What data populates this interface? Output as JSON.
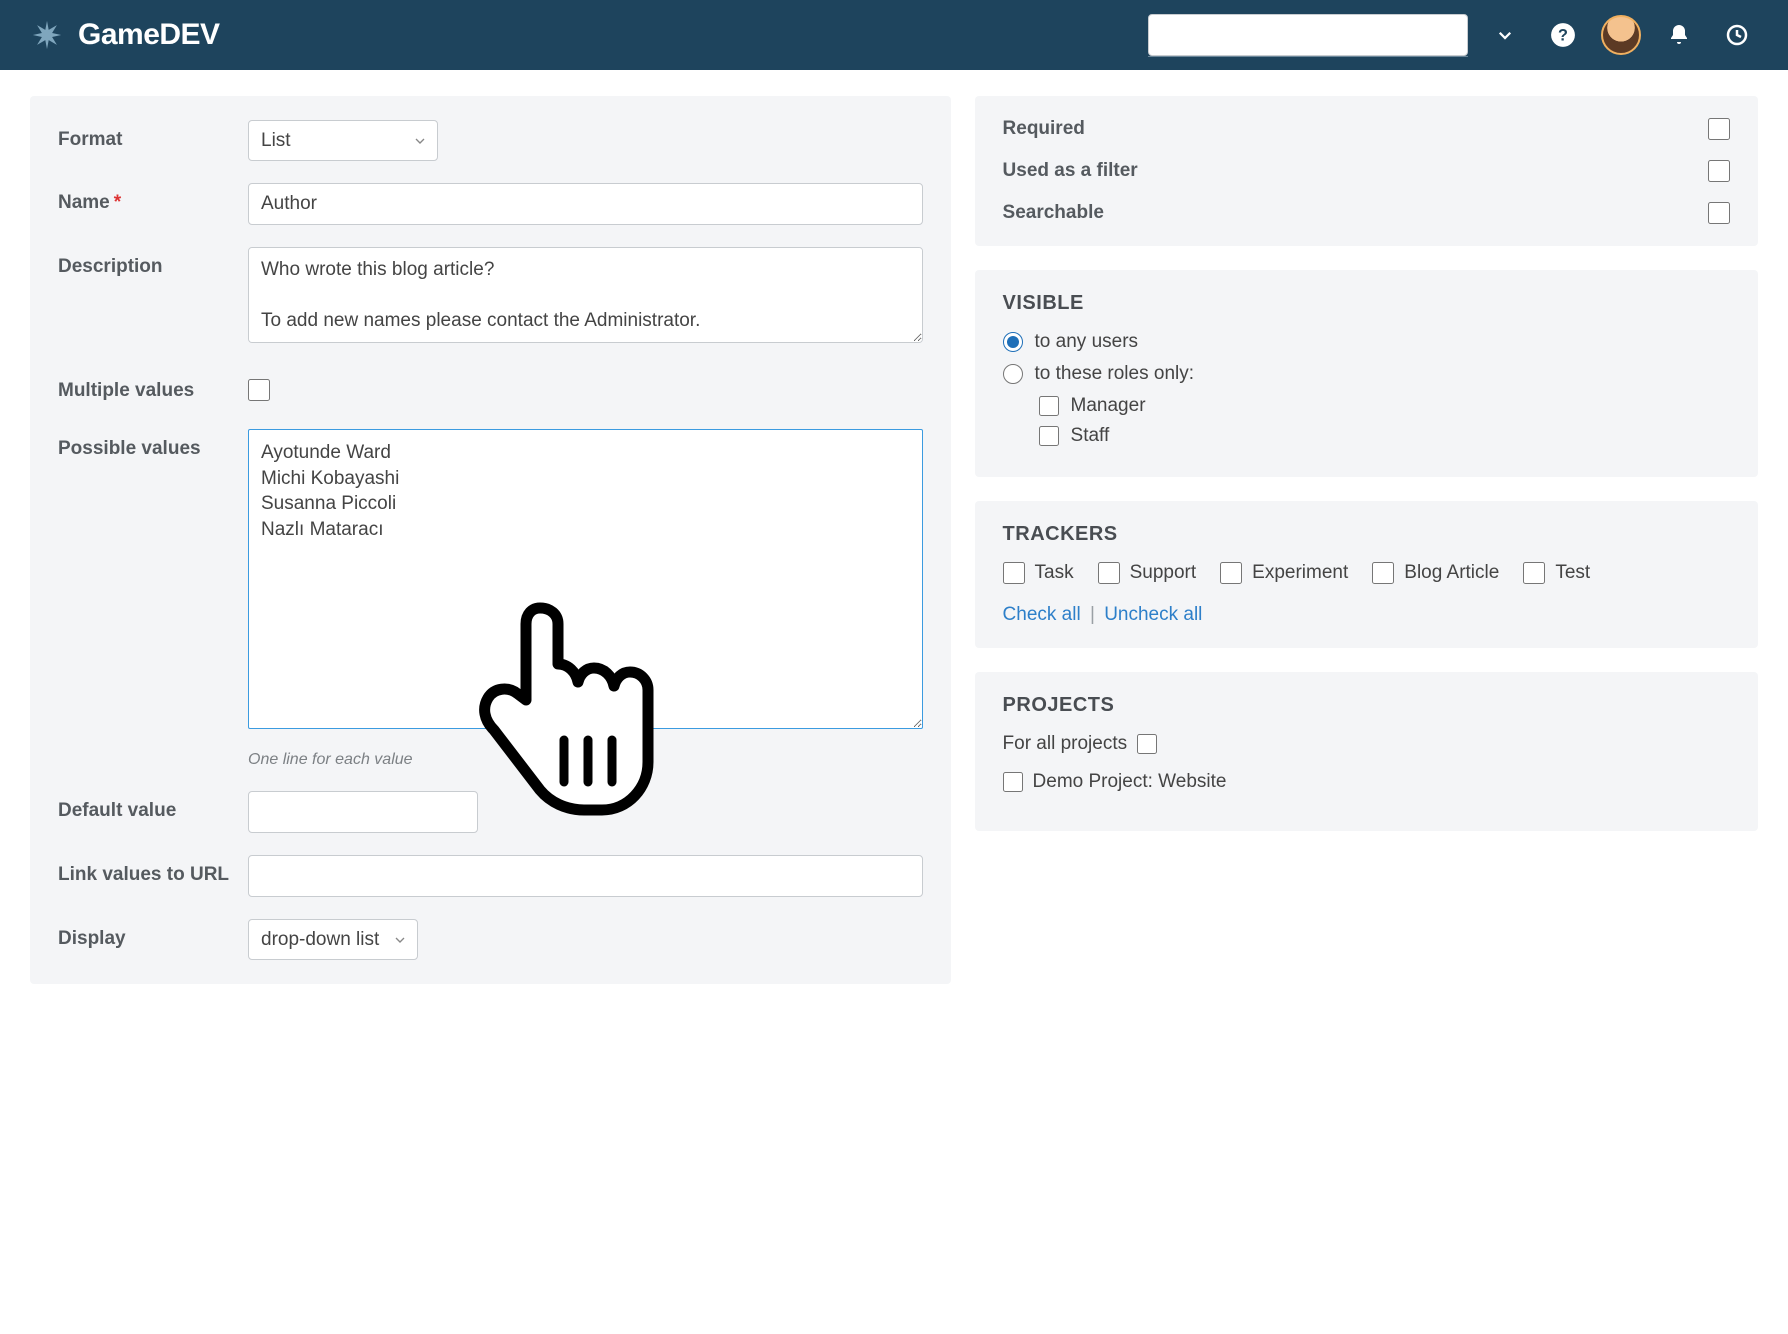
{
  "header": {
    "app_name": "GameDEV"
  },
  "left_form": {
    "format_label": "Format",
    "format_value": "List",
    "name_label": "Name",
    "name_value": "Author",
    "description_label": "Description",
    "description_value": "Who wrote this blog article?\n\nTo add new names please contact the Administrator.",
    "multiple_values_label": "Multiple values",
    "possible_values_label": "Possible values",
    "possible_values_value": "Ayotunde Ward\nMichi Kobayashi\nSusanna Piccoli\nNazlı Mataracı",
    "possible_values_hint": "One line for each value",
    "default_value_label": "Default value",
    "link_values_label": "Link values to URL",
    "display_label": "Display",
    "display_value": "drop-down list"
  },
  "options_panel": {
    "required": "Required",
    "used_as_filter": "Used as a filter",
    "searchable": "Searchable"
  },
  "visible_panel": {
    "title": "VISIBLE",
    "any_users": "to any users",
    "roles_only": "to these roles only:",
    "role_manager": "Manager",
    "role_staff": "Staff"
  },
  "trackers_panel": {
    "title": "TRACKERS",
    "items": [
      "Task",
      "Support",
      "Experiment",
      "Blog Article",
      "Test"
    ],
    "check_all": "Check all",
    "uncheck_all": "Uncheck all"
  },
  "projects_panel": {
    "title": "PROJECTS",
    "for_all": "For all projects",
    "project_1": "Demo Project: Website"
  }
}
